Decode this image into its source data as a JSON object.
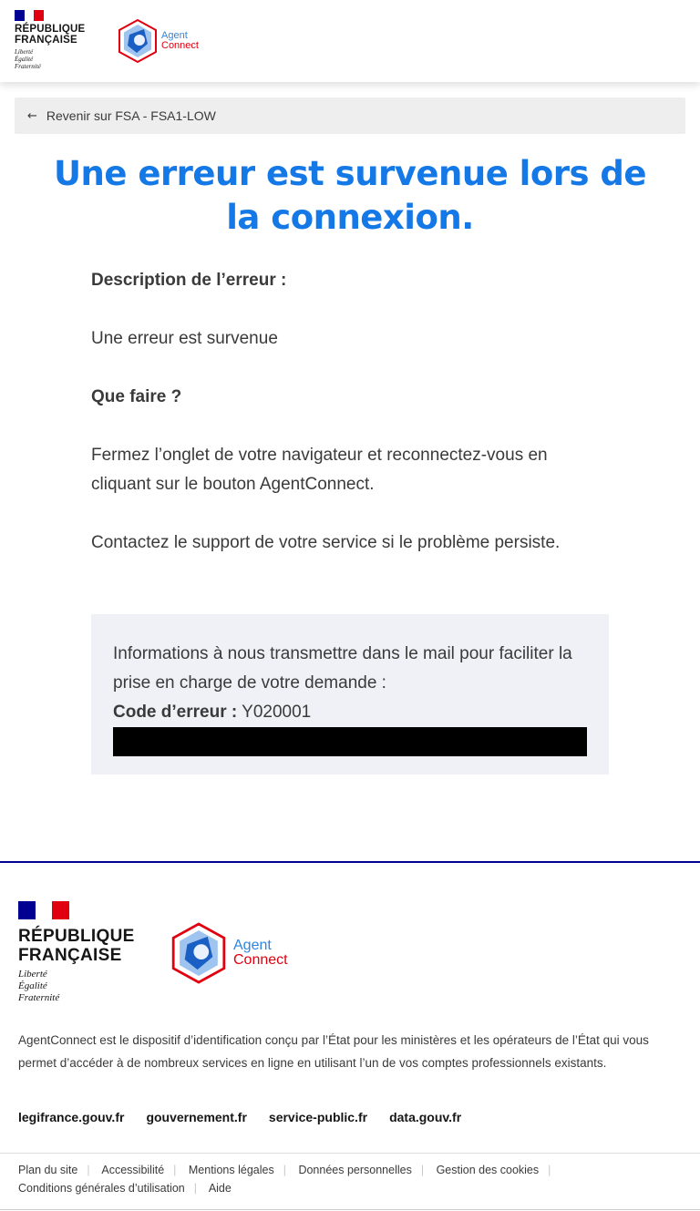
{
  "header": {
    "republic_line1": "RÉPUBLIQUE",
    "republic_line2": "FRANÇAISE",
    "motto": [
      "Liberté",
      "Égalité",
      "Fraternité"
    ],
    "logo_word1": "Agent",
    "logo_word2": "Connect"
  },
  "back_link": {
    "label": "Revenir sur FSA - FSA1-LOW",
    "icon": "arrow-left-icon"
  },
  "main": {
    "title": "Une erreur est survenue lors de la connexion.",
    "description_heading": "Description de l’erreur :",
    "description_text": "Une erreur est survenue",
    "what_to_do_heading": "Que faire ?",
    "instruction_1": "Fermez l’onglet de votre navigateur et reconnectez-vous en cliquant sur le bouton AgentConnect.",
    "instruction_2": "Contactez le support de votre service si le problème persiste."
  },
  "infobox": {
    "intro": "Informations à nous transmettre dans le mail pour faciliter la prise en charge de votre demande :",
    "code_label": "Code d’erreur :",
    "code_value": "Y020001"
  },
  "footer": {
    "description": "AgentConnect est le dispositif d’identification conçu par l’État pour les ministères et les opérateurs de l’État qui vous permet d’accéder à de nombreux services en ligne en utilisant l’un de vos comptes professionnels existants.",
    "links": [
      "legifrance.gouv.fr",
      "gouvernement.fr",
      "service-public.fr",
      "data.gouv.fr"
    ],
    "bottom_links": [
      "Plan du site",
      "Accessibilité",
      "Mentions légales",
      "Données personnelles",
      "Gestion des cookies",
      "Conditions générales d’utilisation",
      "Aide"
    ]
  },
  "colors": {
    "title_blue": "#1478e6",
    "flag_blue": "#000091",
    "flag_red": "#e1000f",
    "infobox_bg": "#eff1f7",
    "backbar_bg": "#eeeeee"
  }
}
